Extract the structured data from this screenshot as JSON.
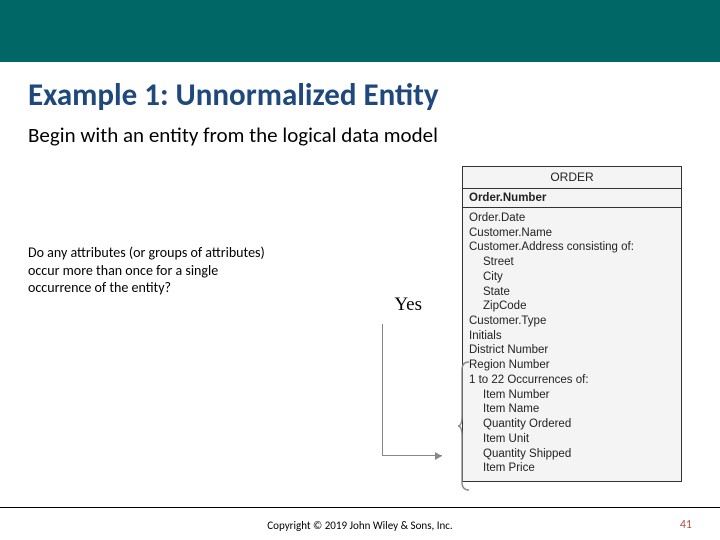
{
  "title": "Example 1: Unnormalized Entity",
  "subtitle": "Begin with an entity from the logical data model",
  "question": "Do any attributes (or groups of attributes) occur more than once for a single occurrence of the entity?",
  "decision": "Yes",
  "entity": {
    "name": "ORDER",
    "pk": "Order.Number",
    "attrs": {
      "order_date": "Order.Date",
      "customer_name": "Customer.Name",
      "customer_address_label": "Customer.Address consisting of:",
      "street": "Street",
      "city": "City",
      "state": "State",
      "zip": "ZipCode",
      "customer_type": "Customer.Type",
      "initials": "Initials",
      "district_number": "District Number",
      "region_number": "Region Number",
      "occurrences_label": "1 to 22 Occurrences of:",
      "item_number": "Item Number",
      "item_name": "Item Name",
      "qty_ordered": "Quantity Ordered",
      "item_unit": "Item Unit",
      "qty_shipped": "Quantity Shipped",
      "item_price": "Item Price"
    }
  },
  "copyright": "Copyright © 2019 John Wiley & Sons, Inc.",
  "page_number": "41"
}
